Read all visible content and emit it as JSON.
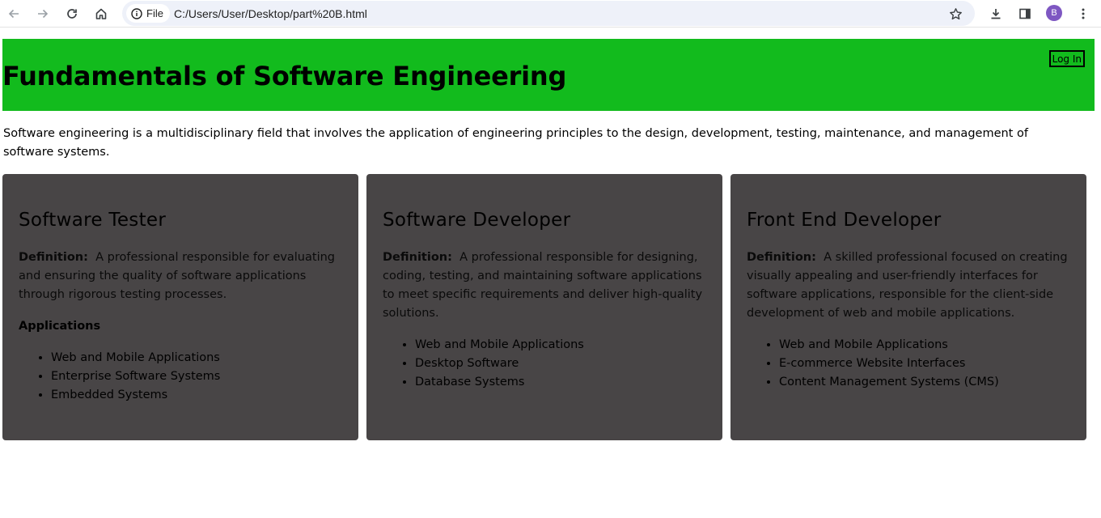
{
  "browser": {
    "site_chip_label": "File",
    "url": "C:/Users/User/Desktop/part%20B.html",
    "profile_initial": "B"
  },
  "header": {
    "title": "Fundamentals of Software Engineering",
    "login_label": "Log In",
    "background_color": "#12bb1d"
  },
  "intro": "Software engineering is a multidisciplinary field that involves the application of engineering principles to the design, development, testing, maintenance, and management of software systems.",
  "cards": [
    {
      "title": "Software Tester",
      "definition_label": "Definition:",
      "definition": "A professional responsible for evaluating and ensuring the quality of software applications through rigorous testing processes.",
      "applications_heading": "Applications",
      "items": [
        "Web and Mobile Applications",
        "Enterprise Software Systems",
        "Embedded Systems"
      ]
    },
    {
      "title": "Software Developer",
      "definition_label": "Definition:",
      "definition": "A professional responsible for designing, coding, testing, and maintaining software applications to meet specific requirements and deliver high-quality solutions.",
      "items": [
        "Web and Mobile Applications",
        "Desktop Software",
        "Database Systems"
      ]
    },
    {
      "title": "Front End Developer",
      "definition_label": "Definition:",
      "definition": "A skilled professional focused on creating visually appealing and user-friendly interfaces for software applications, responsible for the client-side development of web and mobile applications.",
      "items": [
        "Web and Mobile Applications",
        "E-commerce Website Interfaces",
        "Content Management Systems (CMS)"
      ]
    }
  ],
  "colors": {
    "card_background": "#484546",
    "header_green": "#12bb1d"
  }
}
